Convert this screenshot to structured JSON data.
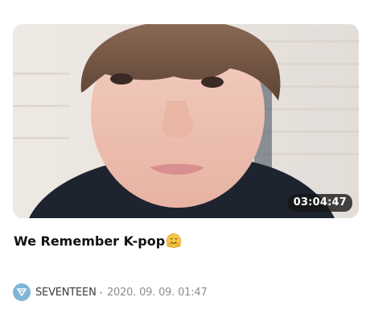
{
  "video": {
    "thumbnail_icon": "video-thumbnail-portrait",
    "duration": "03:04:47",
    "title": "We Remember K-pop",
    "title_emoji_icon": "hugging-face-emoji-icon"
  },
  "channel": {
    "avatar_icon": "seventeen-logo-icon",
    "avatar_color": "#7fb6d7",
    "name": "SEVENTEEN",
    "separator": "·",
    "date": "2020. 09. 09. 01:47"
  }
}
